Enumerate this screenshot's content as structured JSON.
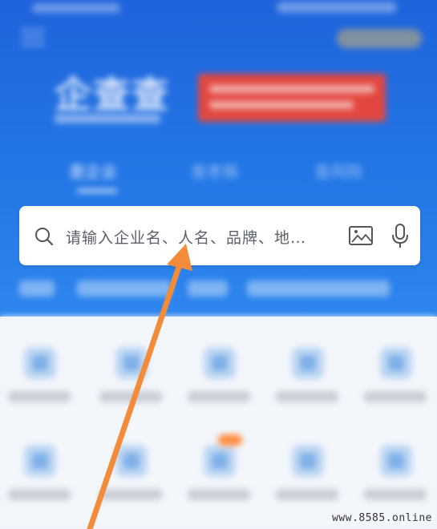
{
  "header": {
    "app_name": "企查查",
    "tabs": [
      {
        "label": "查企业",
        "active": true
      },
      {
        "label": "查老板",
        "active": false
      },
      {
        "label": "查风险",
        "active": false
      }
    ]
  },
  "search": {
    "placeholder": "请输入企业名、人名、品牌、地…",
    "icons": [
      "search-icon",
      "image-search-icon",
      "microphone-icon"
    ]
  },
  "colors": {
    "hero_blue": "#1f63dc",
    "banner_red": "#e2473f",
    "arrow_orange": "#f28c3a"
  },
  "watermark": "www.8585.online"
}
